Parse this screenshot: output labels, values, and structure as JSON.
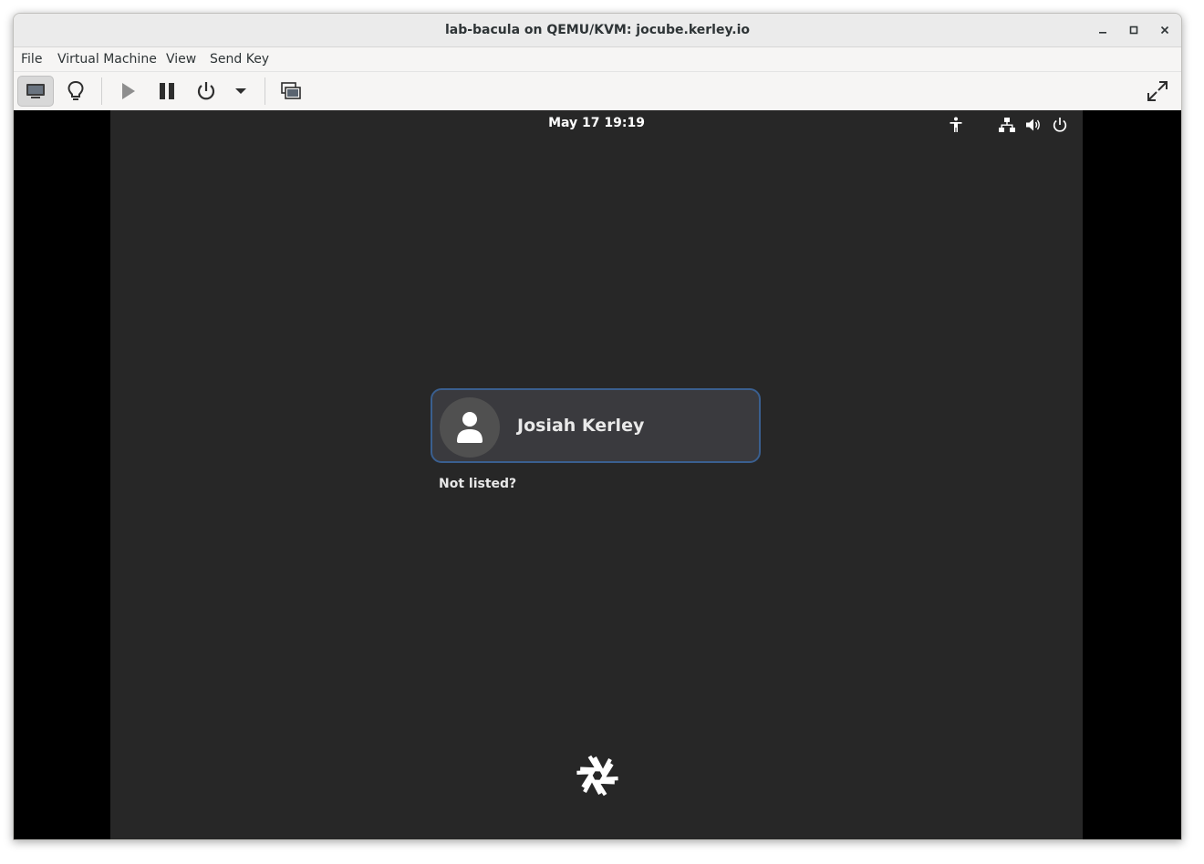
{
  "window": {
    "title": "lab-bacula on QEMU/KVM: jocube.kerley.io",
    "controls": [
      "minimize-icon",
      "maximize-icon",
      "close-icon"
    ]
  },
  "menubar": {
    "items": [
      "File",
      "Virtual Machine",
      "View",
      "Send Key"
    ]
  },
  "toolbar": {
    "buttons": [
      "monitor-icon",
      "lightbulb-icon",
      "play-icon",
      "pause-icon",
      "power-icon",
      "dropdown-arrow-icon",
      "screenshot-icon",
      "fullscreen-icon"
    ]
  },
  "guest": {
    "clock": "May 17  19:19",
    "status_icons": [
      "accessibility-icon",
      "network-icon",
      "volume-icon",
      "power-icon"
    ],
    "user": {
      "name": "Josiah Kerley"
    },
    "not_listed": "Not listed?",
    "logo": "nixos-snowflake-icon"
  },
  "colors": {
    "guest_background": "#272727",
    "card_border": "#3a5f8f",
    "card_background": "#3a3a3e"
  }
}
